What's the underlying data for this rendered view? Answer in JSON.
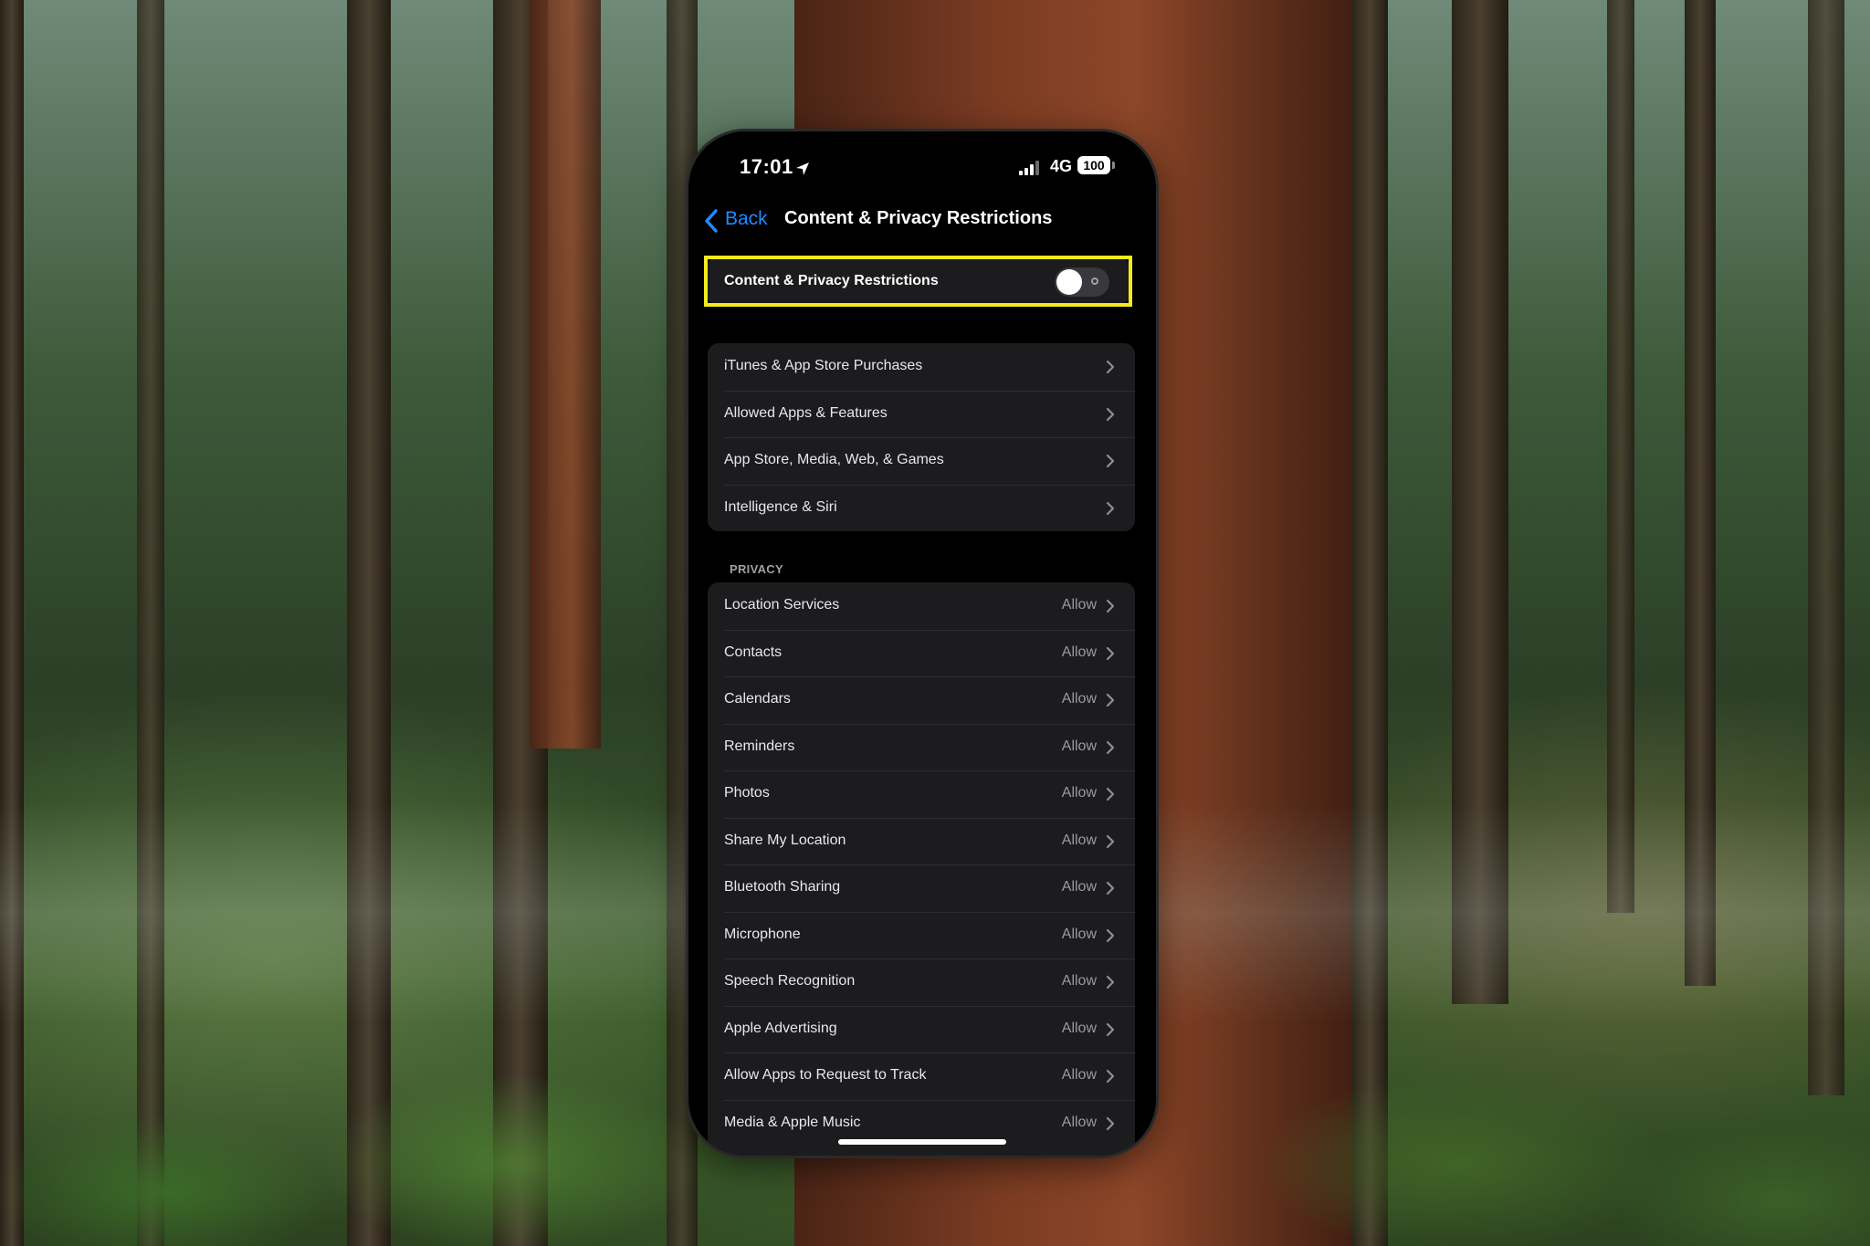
{
  "status_bar": {
    "time": "17:01",
    "network": "4G",
    "battery": "100"
  },
  "nav": {
    "back_label": "Back",
    "title": "Content & Privacy Restrictions"
  },
  "master_toggle": {
    "label": "Content & Privacy Restrictions",
    "state": "off"
  },
  "highlight_color": "#f4ea1c",
  "content_items": [
    {
      "label": "iTunes & App Store Purchases"
    },
    {
      "label": "Allowed Apps & Features"
    },
    {
      "label": "App Store, Media, Web, & Games"
    },
    {
      "label": "Intelligence & Siri"
    }
  ],
  "privacy": {
    "header": "PRIVACY",
    "items": [
      {
        "label": "Location Services",
        "value": "Allow"
      },
      {
        "label": "Contacts",
        "value": "Allow"
      },
      {
        "label": "Calendars",
        "value": "Allow"
      },
      {
        "label": "Reminders",
        "value": "Allow"
      },
      {
        "label": "Photos",
        "value": "Allow"
      },
      {
        "label": "Share My Location",
        "value": "Allow"
      },
      {
        "label": "Bluetooth Sharing",
        "value": "Allow"
      },
      {
        "label": "Microphone",
        "value": "Allow"
      },
      {
        "label": "Speech Recognition",
        "value": "Allow"
      },
      {
        "label": "Apple Advertising",
        "value": "Allow"
      },
      {
        "label": "Allow Apps to Request to Track",
        "value": "Allow"
      },
      {
        "label": "Media & Apple Music",
        "value": "Allow"
      }
    ]
  },
  "icons": {
    "back": "chevron-left-icon",
    "row": "chevron-right-icon",
    "location": "location-arrow-icon",
    "signal": "cellular-signal-icon",
    "battery": "battery-icon"
  },
  "colors": {
    "accent": "#1f8bff",
    "row_bg": "#1c1c1e",
    "screen_bg": "#000000"
  }
}
